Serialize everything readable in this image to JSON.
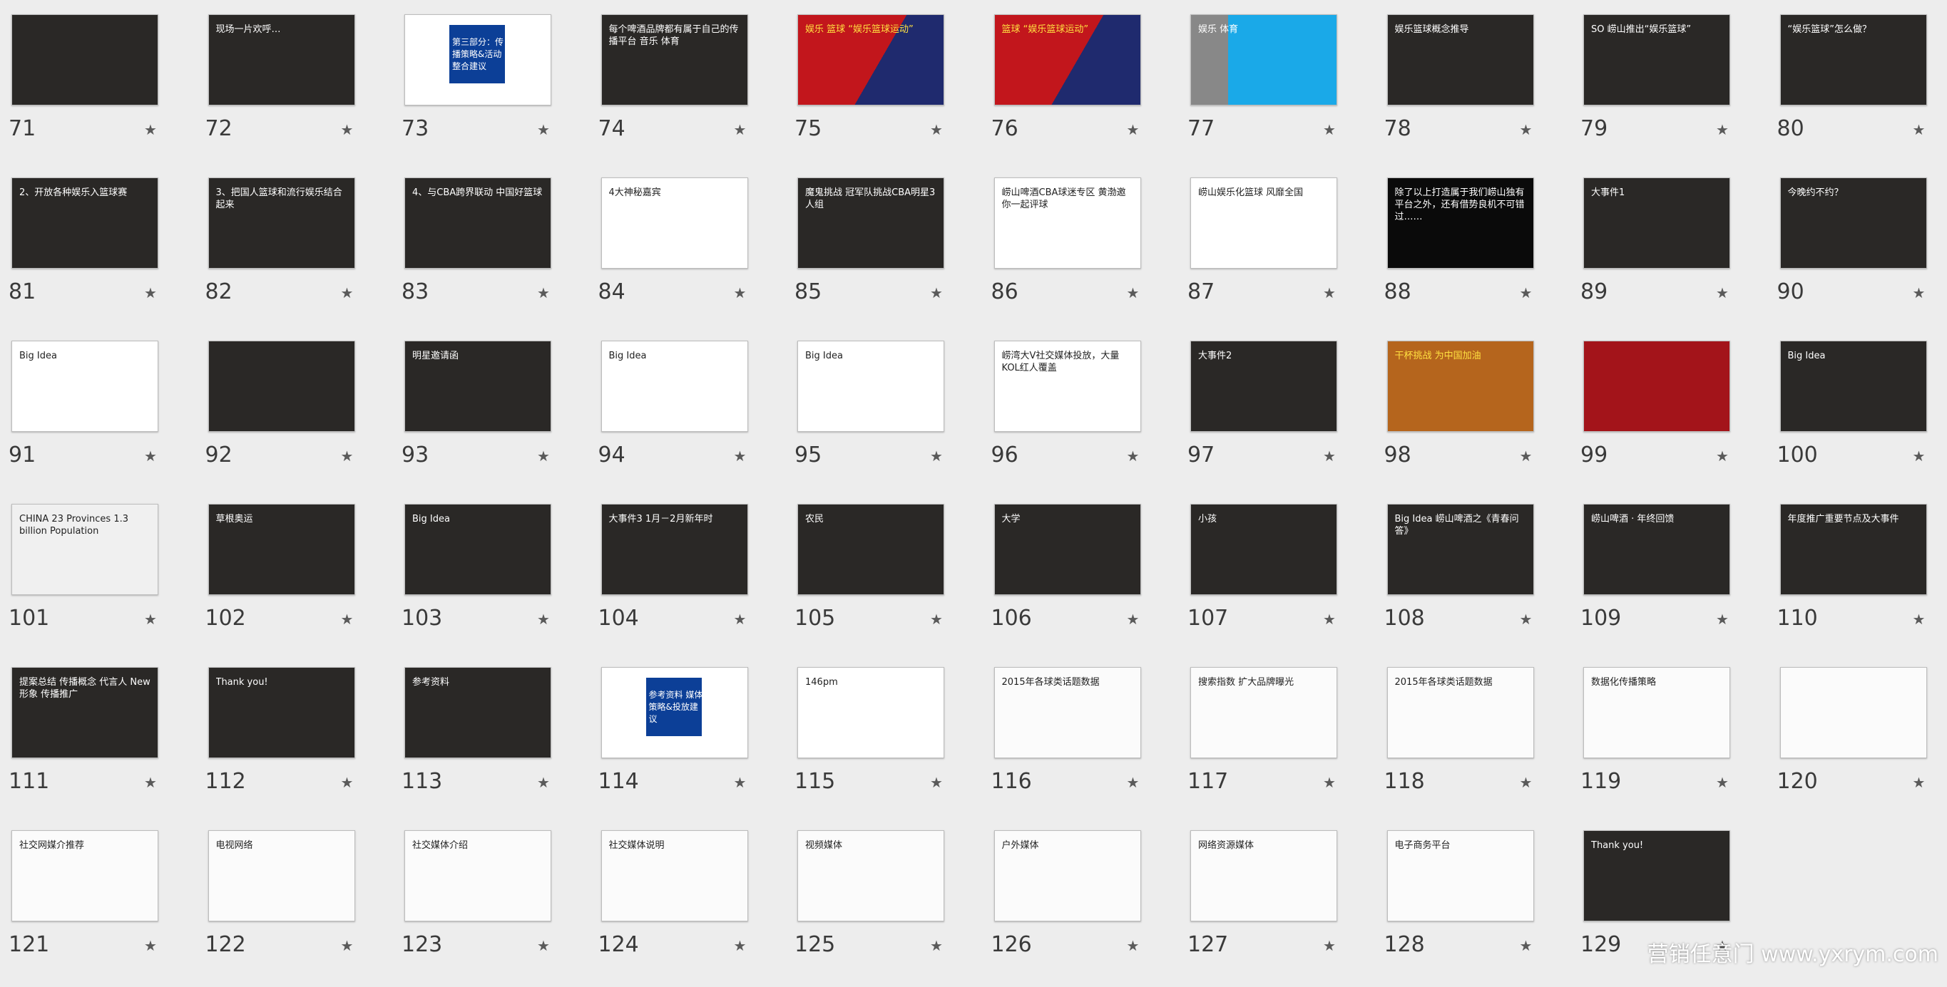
{
  "watermark": "营销任意门 www.yxrym.com",
  "slides": [
    {
      "n": "71",
      "theme": "dark",
      "text": ""
    },
    {
      "n": "72",
      "theme": "dark",
      "text": "现场一片欢呼…"
    },
    {
      "n": "73",
      "theme": "white",
      "text": "第三部分：传播策略&活动整合建议"
    },
    {
      "n": "74",
      "theme": "dark",
      "text": "每个啤酒品牌都有属于自己的传播平台 音乐 体育"
    },
    {
      "n": "75",
      "theme": "red",
      "text": "娱乐 篮球 “娱乐篮球运动”"
    },
    {
      "n": "76",
      "theme": "red",
      "text": "篮球 “娱乐篮球运动”"
    },
    {
      "n": "77",
      "theme": "sport",
      "text": "娱乐 体育"
    },
    {
      "n": "78",
      "theme": "dark",
      "text": "娱乐篮球概念推导"
    },
    {
      "n": "79",
      "theme": "dark",
      "text": "SO 崂山推出“娱乐篮球”"
    },
    {
      "n": "80",
      "theme": "dark",
      "text": "“娱乐篮球”怎么做？"
    },
    {
      "n": "81",
      "theme": "dark",
      "text": "2、开放各种娱乐入篮球赛"
    },
    {
      "n": "82",
      "theme": "dark",
      "text": "3、把国人篮球和流行娱乐结合起来"
    },
    {
      "n": "83",
      "theme": "dark",
      "text": "4、与CBA跨界联动 中国好篮球"
    },
    {
      "n": "84",
      "theme": "white",
      "text": "4大神秘嘉宾"
    },
    {
      "n": "85",
      "theme": "dark",
      "text": "魔鬼挑战 冠军队挑战CBA明星3人组"
    },
    {
      "n": "86",
      "theme": "white",
      "text": "崂山啤酒CBA球迷专区 黄渤邀你一起评球"
    },
    {
      "n": "87",
      "theme": "white",
      "text": "崂山娱乐化篮球 风靡全国"
    },
    {
      "n": "88",
      "theme": "black",
      "text": "除了以上打造属于我们崂山独有平台之外，还有借势良机不可错过……"
    },
    {
      "n": "89",
      "theme": "dark",
      "text": "大事件1"
    },
    {
      "n": "90",
      "theme": "dark",
      "text": "今晚约不约？"
    },
    {
      "n": "91",
      "theme": "white",
      "text": "Big Idea"
    },
    {
      "n": "92",
      "theme": "dark",
      "text": ""
    },
    {
      "n": "93",
      "theme": "dark",
      "text": "明星邀请函"
    },
    {
      "n": "94",
      "theme": "white",
      "text": "Big Idea"
    },
    {
      "n": "95",
      "theme": "white",
      "text": "Big Idea"
    },
    {
      "n": "96",
      "theme": "white",
      "text": "崂湾大V社交媒体投放，大量KOL红人覆盖"
    },
    {
      "n": "97",
      "theme": "dark",
      "text": "大事件2"
    },
    {
      "n": "98",
      "theme": "orange",
      "text": "干杯挑战 为中国加油"
    },
    {
      "n": "99",
      "theme": "red",
      "text": ""
    },
    {
      "n": "100",
      "theme": "dark",
      "text": "Big Idea"
    },
    {
      "n": "101",
      "theme": "china",
      "text": "CHINA 23 Provinces 1.3 billion Population"
    },
    {
      "n": "102",
      "theme": "dark",
      "text": "草根奥运"
    },
    {
      "n": "103",
      "theme": "dark",
      "text": "Big Idea"
    },
    {
      "n": "104",
      "theme": "dark",
      "text": "大事件3 1月－2月新年时"
    },
    {
      "n": "105",
      "theme": "dark",
      "text": "农民"
    },
    {
      "n": "106",
      "theme": "dark",
      "text": "大学"
    },
    {
      "n": "107",
      "theme": "dark",
      "text": "小孩"
    },
    {
      "n": "108",
      "theme": "dark",
      "text": "Big Idea 崂山啤酒之《青春问答》"
    },
    {
      "n": "109",
      "theme": "dark",
      "text": "崂山啤酒 · 年终回馈"
    },
    {
      "n": "110",
      "theme": "dark",
      "text": "年度推广重要节点及大事件"
    },
    {
      "n": "111",
      "theme": "dark",
      "text": "提案总结 传播概念 代言人 New形象 传播推广"
    },
    {
      "n": "112",
      "theme": "dark",
      "text": "Thank you!"
    },
    {
      "n": "113",
      "theme": "dark",
      "text": "参考资料"
    },
    {
      "n": "114",
      "theme": "white",
      "text": "参考资料 媒体策略&投放建议"
    },
    {
      "n": "115",
      "theme": "white",
      "text": "146pm"
    },
    {
      "n": "116",
      "theme": "doc",
      "text": "2015年各球类话题数据"
    },
    {
      "n": "117",
      "theme": "doc",
      "text": "搜索指数 扩大品牌曝光"
    },
    {
      "n": "118",
      "theme": "doc",
      "text": "2015年各球类话题数据"
    },
    {
      "n": "119",
      "theme": "doc",
      "text": "数据化传播策略"
    },
    {
      "n": "120",
      "theme": "doc",
      "text": ""
    },
    {
      "n": "121",
      "theme": "doc",
      "text": "社交网媒介推荐"
    },
    {
      "n": "122",
      "theme": "doc",
      "text": "电视网络"
    },
    {
      "n": "123",
      "theme": "doc",
      "text": "社交媒体介绍"
    },
    {
      "n": "124",
      "theme": "doc",
      "text": "社交媒体说明"
    },
    {
      "n": "125",
      "theme": "doc",
      "text": "视频媒体"
    },
    {
      "n": "126",
      "theme": "doc",
      "text": "户外媒体"
    },
    {
      "n": "127",
      "theme": "doc",
      "text": "网络资源媒体"
    },
    {
      "n": "128",
      "theme": "doc",
      "text": "电子商务平台"
    },
    {
      "n": "129",
      "theme": "dark",
      "text": "Thank you!"
    }
  ]
}
